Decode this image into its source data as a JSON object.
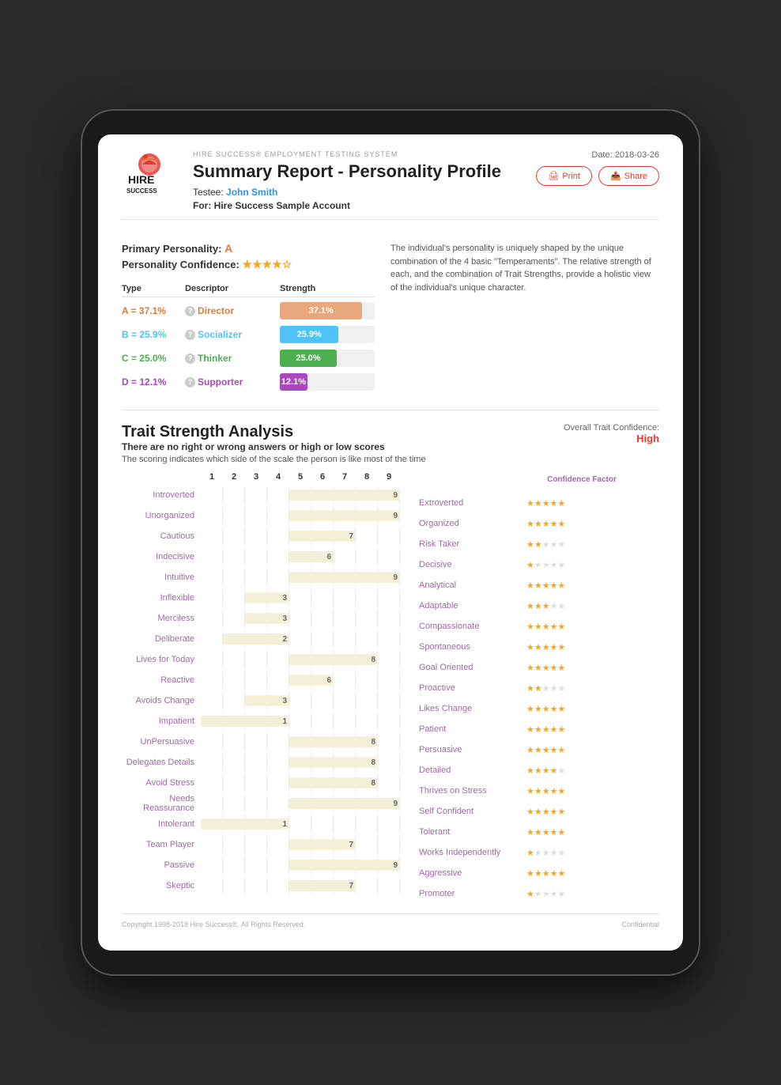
{
  "tablet": {
    "system_title": "HIRE SUCCESS® EMPLOYMENT TESTING SYSTEM",
    "date_label": "Date: 2018-03-26",
    "report_title": "Summary Report - Personality Profile",
    "testee_label": "Testee:",
    "testee_name": "John Smith",
    "for_label": "For: Hire Success Sample Account",
    "print_label": "Print",
    "share_label": "Share"
  },
  "personality": {
    "primary_label": "Primary Personality:",
    "primary_value": "A",
    "confidence_label": "Personality Confidence:",
    "confidence_stars": 4,
    "description": "The individual's personality is uniquely shaped by the unique combination of the 4 basic \"Temperaments\". The relative strength of each, and the combination of Trait Strengths, provide a holistic view of the individual's unique character.",
    "type_header": "Type",
    "descriptor_header": "Descriptor",
    "strength_header": "Strength",
    "types": [
      {
        "id": "a",
        "label": "A = 37.1%",
        "descriptor": "Director",
        "pct": 37.1,
        "pct_label": "37.1%"
      },
      {
        "id": "b",
        "label": "B = 25.9%",
        "descriptor": "Socializer",
        "pct": 25.9,
        "pct_label": "25.9%"
      },
      {
        "id": "c",
        "label": "C = 25.0%",
        "descriptor": "Thinker",
        "pct": 25.0,
        "pct_label": "25.0%"
      },
      {
        "id": "d",
        "label": "D = 12.1%",
        "descriptor": "Supporter",
        "pct": 12.1,
        "pct_label": "12.1%"
      }
    ]
  },
  "tsa": {
    "title": "Trait Strength Analysis",
    "subtitle": "There are no right or wrong answers or high or low scores",
    "description": "The scoring indicates which side of the scale the person is like most of the time",
    "confidence_label": "Overall Trait Confidence:",
    "confidence_value": "High",
    "confidence_factor_label": "Confidence Factor",
    "traits": [
      {
        "left": "Introverted",
        "right": "Extroverted",
        "value": 9,
        "stars": 5
      },
      {
        "left": "Unorganized",
        "right": "Organized",
        "value": 9,
        "stars": 5
      },
      {
        "left": "Cautious",
        "right": "Risk Taker",
        "value": 7,
        "stars": 2
      },
      {
        "left": "Indecisive",
        "right": "Decisive",
        "value": 6,
        "stars": 1
      },
      {
        "left": "Intuitive",
        "right": "Analytical",
        "value": 9,
        "stars": 5
      },
      {
        "left": "Inflexible",
        "right": "Adaptable",
        "value": 3,
        "stars": 3
      },
      {
        "left": "Merciless",
        "right": "Compassionate",
        "value": 3,
        "stars": 5
      },
      {
        "left": "Deliberate",
        "right": "Spontaneous",
        "value": 2,
        "stars": 5
      },
      {
        "left": "Lives for Today",
        "right": "Goal Oriented",
        "value": 8,
        "stars": 5
      },
      {
        "left": "Reactive",
        "right": "Proactive",
        "value": 6,
        "stars": 2
      },
      {
        "left": "Avoids Change",
        "right": "Likes Change",
        "value": 3,
        "stars": 5
      },
      {
        "left": "Impatient",
        "right": "Patient",
        "value": 1,
        "stars": 5
      },
      {
        "left": "UnPersuasive",
        "right": "Persuasive",
        "value": 8,
        "stars": 5
      },
      {
        "left": "Delegates Details",
        "right": "Detailed",
        "value": 8,
        "stars": 4
      },
      {
        "left": "Avoid Stress",
        "right": "Thrives on Stress",
        "value": 8,
        "stars": 5
      },
      {
        "left": "Needs Reassurance",
        "right": "Self Confident",
        "value": 9,
        "stars": 5
      },
      {
        "left": "Intolerant",
        "right": "Tolerant",
        "value": 1,
        "stars": 5
      },
      {
        "left": "Team Player",
        "right": "Works Independently",
        "value": 7,
        "stars": 1
      },
      {
        "left": "Passive",
        "right": "Aggressive",
        "value": 9,
        "stars": 5
      },
      {
        "left": "Skeptic",
        "right": "Promoter",
        "value": 7,
        "stars": 1
      }
    ]
  },
  "footer": {
    "copyright": "Copyright 1998-2018 Hire Success®. All Rights Reserved.",
    "confidential": "Confidential"
  }
}
